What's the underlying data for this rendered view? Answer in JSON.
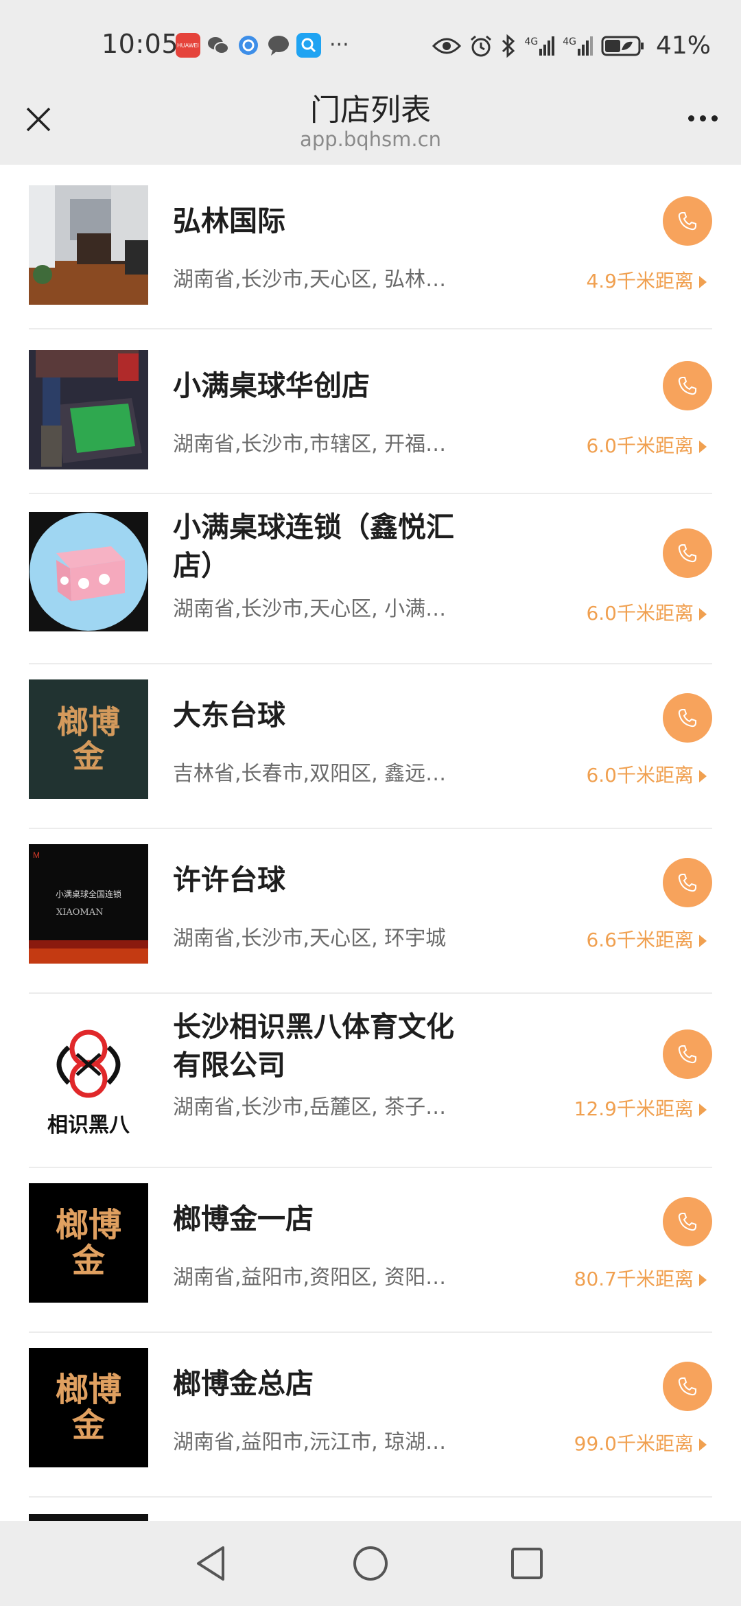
{
  "status_bar": {
    "time": "10:05",
    "app_badge": "HUAWEI",
    "battery_percent": "41%",
    "network_1": "4G",
    "network_2": "4G"
  },
  "nav": {
    "title": "门店列表",
    "subtitle": "app.bqhsm.cn"
  },
  "accent_color": "#f7a35c",
  "stores": [
    {
      "name": "弘林国际",
      "address": "湖南省,长沙市,天心区, 弘林…",
      "distance": "4.9千米距离"
    },
    {
      "name": "小满桌球华创店",
      "address": "湖南省,长沙市,市辖区, 开福…",
      "distance": "6.0千米距离"
    },
    {
      "name": "小满桌球连锁（鑫悦汇店）",
      "address": "湖南省,长沙市,天心区, 小满…",
      "distance": "6.0千米距离"
    },
    {
      "name": "大东台球",
      "address": "吉林省,长春市,双阳区, 鑫远…",
      "distance": "6.0千米距离",
      "logo_text": "榔博金"
    },
    {
      "name": "许许台球",
      "address": "湖南省,长沙市,天心区, 环宇城",
      "distance": "6.6千米距离",
      "logo_text": "小满桌球全国连锁",
      "logo_text_2": "XIAOMAN"
    },
    {
      "name": "长沙相识黑八体育文化有限公司",
      "address": "湖南省,长沙市,岳麓区, 茶子…",
      "distance": "12.9千米距离",
      "logo_text": "相识黑八"
    },
    {
      "name": "榔博金一店",
      "address": "湖南省,益阳市,资阳区, 资阳…",
      "distance": "80.7千米距离",
      "logo_text": "榔博金"
    },
    {
      "name": "榔博金总店",
      "address": "湖南省,益阳市,沅江市, 琼湖…",
      "distance": "99.0千米距离",
      "logo_text": "榔博金"
    }
  ]
}
